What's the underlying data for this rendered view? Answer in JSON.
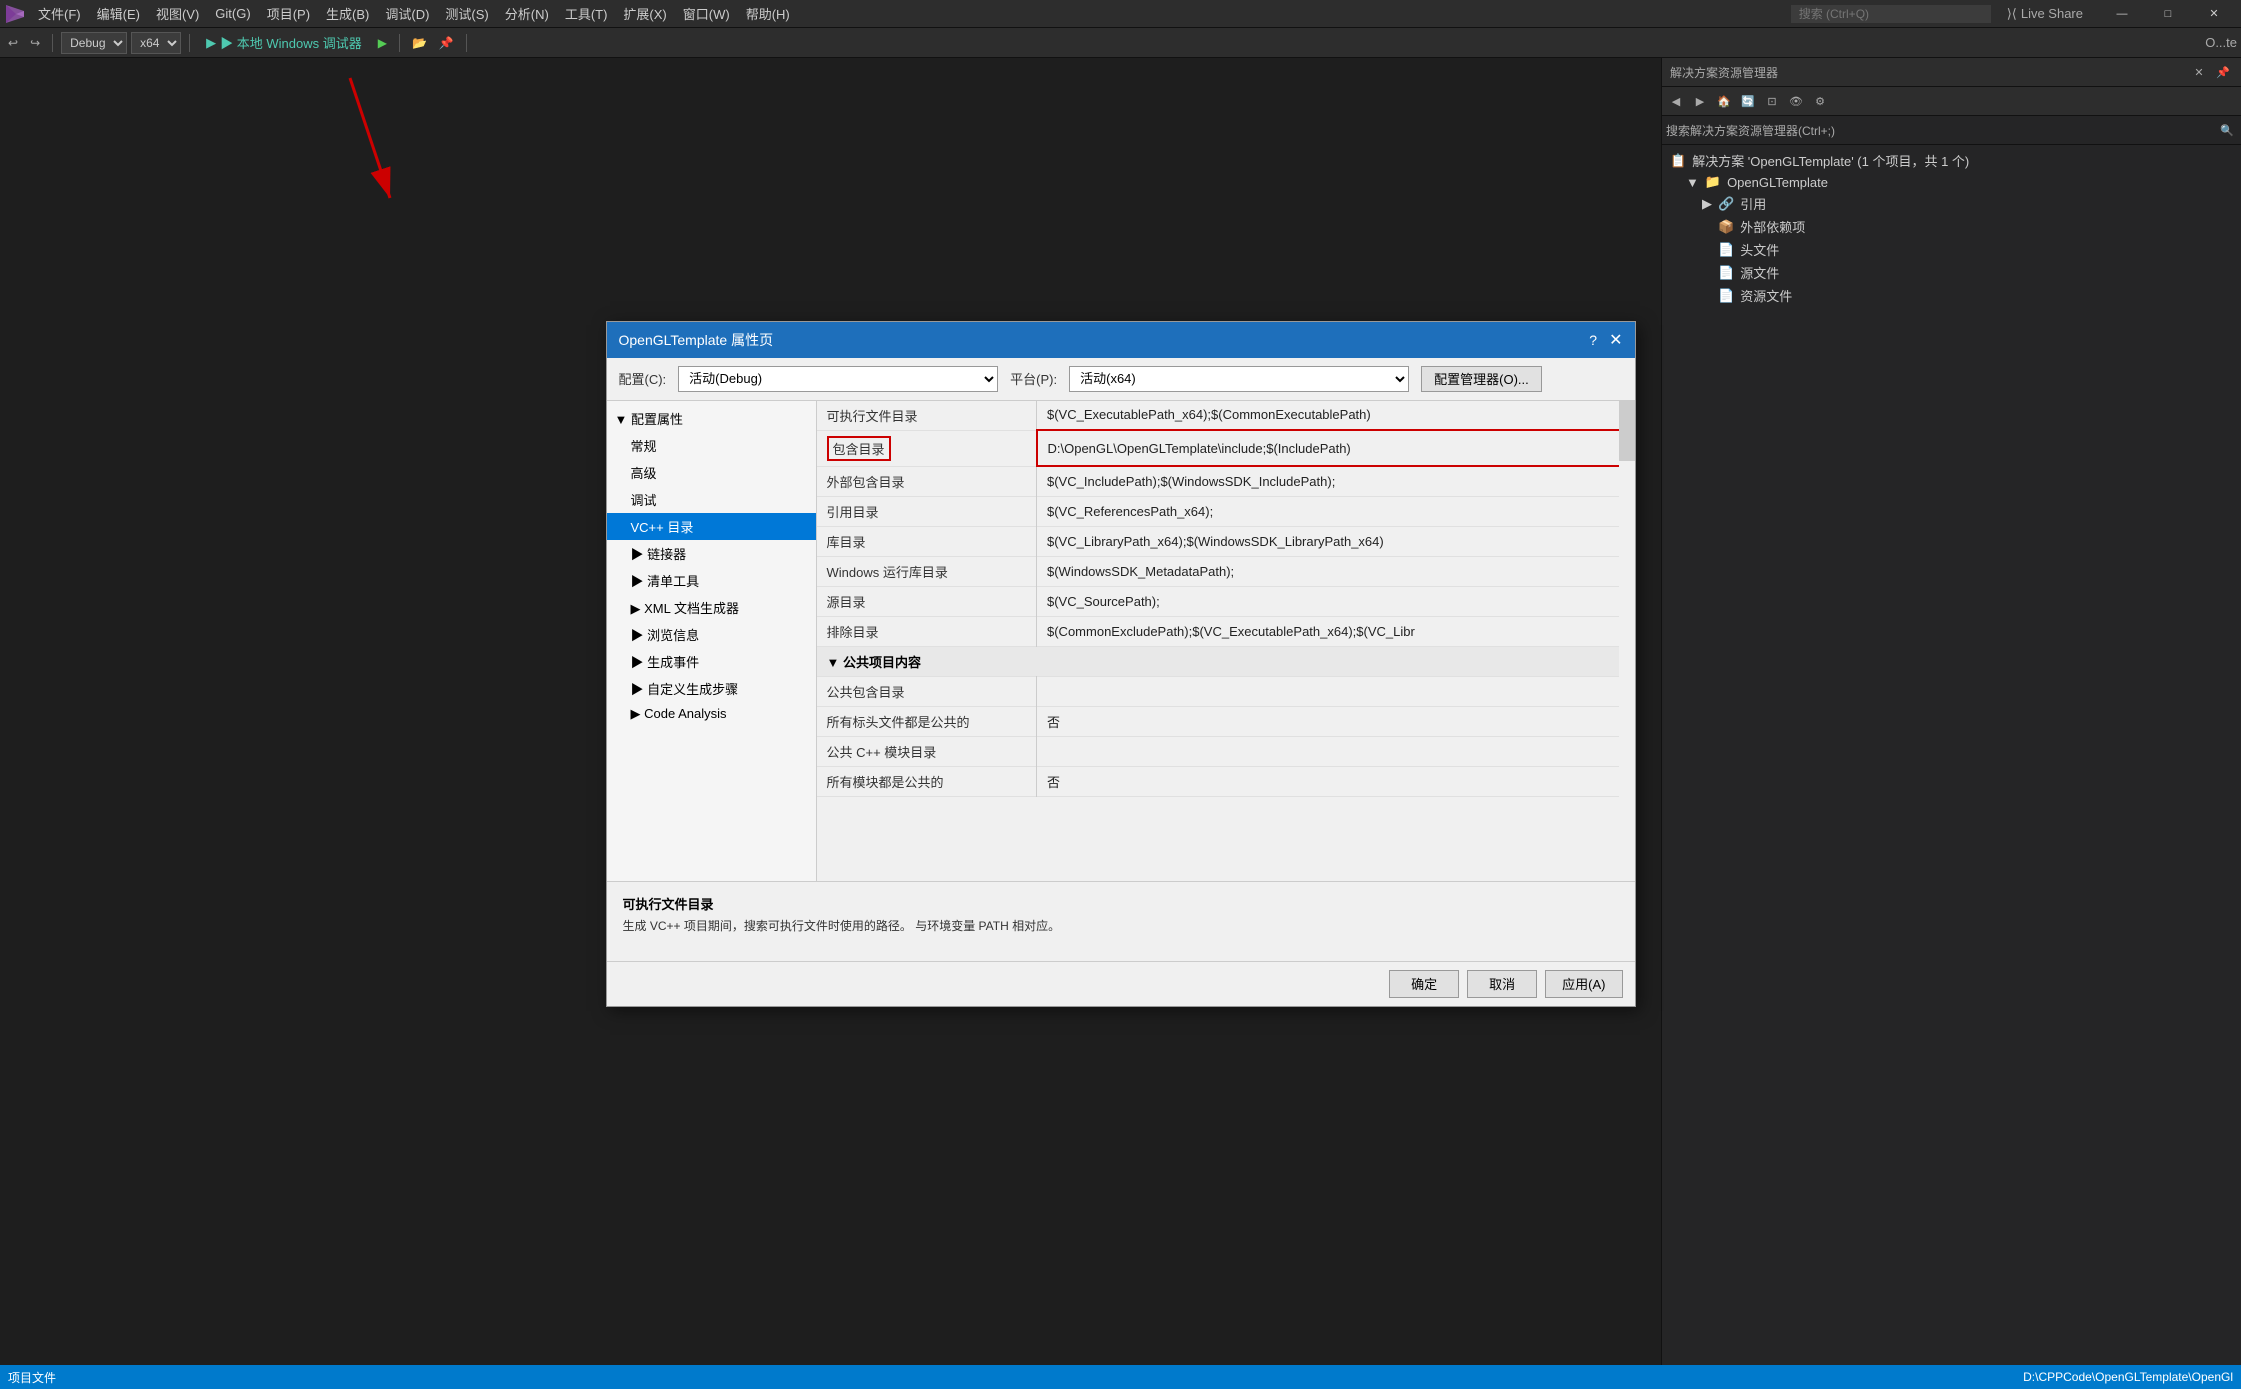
{
  "window": {
    "title": "O...te"
  },
  "menubar": {
    "logo": "⊗",
    "items": [
      {
        "label": "文件(F)"
      },
      {
        "label": "编辑(E)"
      },
      {
        "label": "视图(V)"
      },
      {
        "label": "Git(G)"
      },
      {
        "label": "项目(P)"
      },
      {
        "label": "生成(B)"
      },
      {
        "label": "调试(D)"
      },
      {
        "label": "测试(S)"
      },
      {
        "label": "分析(N)"
      },
      {
        "label": "工具(T)"
      },
      {
        "label": "扩展(X)"
      },
      {
        "label": "窗口(W)"
      },
      {
        "label": "帮助(H)"
      }
    ],
    "search_placeholder": "搜索 (Ctrl+Q)",
    "live_share": "Live Share",
    "window_controls": {
      "minimize": "—",
      "maximize": "□",
      "close": "✕"
    }
  },
  "toolbar": {
    "config": "Debug",
    "platform": "x64",
    "run_label": "▶ 本地 Windows 调试器",
    "title": "O...te"
  },
  "solution_explorer": {
    "title": "解决方案资源管理器",
    "search_label": "搜索解决方案资源管理器(Ctrl+;)",
    "tree": [
      {
        "label": "解决方案 'OpenGLTemplate' (1 个项目，共 1 个)",
        "indent": 0,
        "icon": "📋"
      },
      {
        "label": "OpenGLTemplate",
        "indent": 1,
        "icon": "📁"
      },
      {
        "label": "引用",
        "indent": 2,
        "icon": "🔗"
      },
      {
        "label": "外部依赖项",
        "indent": 3,
        "icon": "📦"
      },
      {
        "label": "头文件",
        "indent": 3,
        "icon": "📄"
      },
      {
        "label": "源文件",
        "indent": 3,
        "icon": "📄"
      },
      {
        "label": "资源文件",
        "indent": 3,
        "icon": "📄"
      }
    ]
  },
  "dialog": {
    "title": "OpenGLTemplate 属性页",
    "help": "?",
    "close": "✕",
    "config_label": "配置(C):",
    "config_value": "活动(Debug)",
    "platform_label": "平台(P):",
    "platform_value": "活动(x64)",
    "config_mgr_label": "配置管理器(O)...",
    "left_tree": [
      {
        "label": "▼ 配置属性",
        "level": 0,
        "selected": false
      },
      {
        "label": "常规",
        "level": 1
      },
      {
        "label": "高级",
        "level": 1
      },
      {
        "label": "调试",
        "level": 1
      },
      {
        "label": "VC++ 目录",
        "level": 1,
        "selected": true
      },
      {
        "label": "▶ 链接器",
        "level": 1
      },
      {
        "label": "▶ 清单工具",
        "level": 1
      },
      {
        "label": "▶ XML 文档生成器",
        "level": 1
      },
      {
        "label": "▶ 浏览信息",
        "level": 1
      },
      {
        "label": "▶ 生成事件",
        "level": 1
      },
      {
        "label": "▶ 自定义生成步骤",
        "level": 1
      },
      {
        "label": "▶ Code Analysis",
        "level": 1
      }
    ],
    "props": [
      {
        "name": "可执行文件目录",
        "value": "$(VC_ExecutablePath_x64);$(CommonExecutablePath)",
        "highlight_name": false,
        "highlight_value": false
      },
      {
        "name": "包含目录",
        "value": "D:\\OpenGL\\OpenGLTemplate\\include;$(IncludePath)",
        "highlight_name": true,
        "highlight_value": true
      },
      {
        "name": "外部包含目录",
        "value": "$(VC_IncludePath);$(WindowsSDK_IncludePath);",
        "highlight_name": false,
        "highlight_value": false
      },
      {
        "name": "引用目录",
        "value": "$(VC_ReferencesPath_x64);",
        "highlight_name": false,
        "highlight_value": false
      },
      {
        "name": "库目录",
        "value": "$(VC_LibraryPath_x64);$(WindowsSDK_LibraryPath_x64)",
        "highlight_name": false,
        "highlight_value": false
      },
      {
        "name": "Windows 运行库目录",
        "value": "$(WindowsSDK_MetadataPath);",
        "highlight_name": false,
        "highlight_value": false
      },
      {
        "name": "源目录",
        "value": "$(VC_SourcePath);",
        "highlight_name": false,
        "highlight_value": false
      },
      {
        "name": "排除目录",
        "value": "$(CommonExcludePath);$(VC_ExecutablePath_x64);$(VC_Libr",
        "highlight_name": false,
        "highlight_value": false
      }
    ],
    "public_section": {
      "label": "▼ 公共项目内容",
      "items": [
        {
          "name": "公共包含目录",
          "value": ""
        },
        {
          "name": "所有标头文件都是公共的",
          "value": "否"
        },
        {
          "name": "公共 C++ 模块目录",
          "value": ""
        },
        {
          "name": "所有模块都是公共的",
          "value": "否"
        }
      ]
    },
    "description": {
      "title": "可执行文件目录",
      "text": "生成 VC++ 项目期间，搜索可执行文件时使用的路径。 与环境变量 PATH 相对应。"
    },
    "buttons": {
      "ok": "确定",
      "cancel": "取消",
      "apply": "应用(A)"
    }
  },
  "statusbar": {
    "left": "项目文件",
    "right": "D:\\CPPCode\\OpenGLTemplate\\OpenGl"
  }
}
